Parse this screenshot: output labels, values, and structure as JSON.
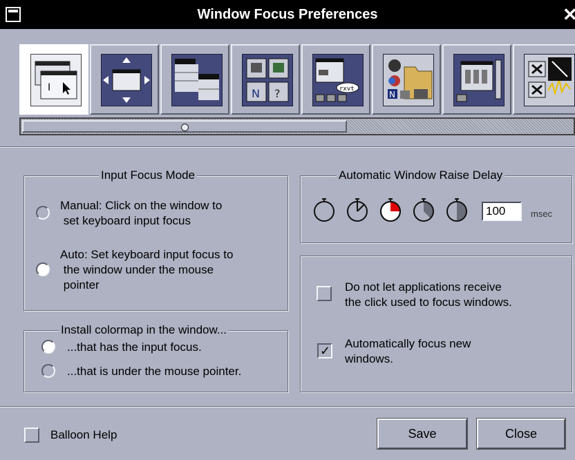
{
  "window": {
    "title": "Window Focus Preferences"
  },
  "toolbar": {
    "items": [
      {
        "icon": "focus-window-icon",
        "active": true
      },
      {
        "icon": "move-window-icon",
        "active": false
      },
      {
        "icon": "window-stack-icon",
        "active": false
      },
      {
        "icon": "icon-box-icon",
        "active": false
      },
      {
        "icon": "terminal-window-icon",
        "active": false
      },
      {
        "icon": "folder-apps-icon",
        "active": false
      },
      {
        "icon": "workspace-windows-icon",
        "active": false
      },
      {
        "icon": "close-window-icon",
        "active": false
      }
    ]
  },
  "input_focus": {
    "legend": "Input Focus Mode",
    "manual_line1": "Manual:  Click on the window to",
    "manual_line2": " set keyboard input focus",
    "auto_line1": "Auto:  Set keyboard input focus to",
    "auto_line2": " the window under the mouse",
    "auto_line3": " pointer",
    "selected": "auto"
  },
  "colormap": {
    "legend": "Install colormap in the window...",
    "option1": "...that has the input focus.",
    "option2": "...that is under the mouse pointer.",
    "selected": "option1"
  },
  "raise_delay": {
    "legend": "Automatic Window Raise Delay",
    "value": "100",
    "unit": "msec",
    "selected_timer": 3
  },
  "options": {
    "no_click_line1": "Do not let applications receive",
    "no_click_line2": "the click used to focus windows.",
    "no_click_checked": false,
    "auto_focus_line1": "Automatically focus new",
    "auto_focus_line2": "windows.",
    "auto_focus_checked": true
  },
  "footer": {
    "balloon_help": "Balloon Help",
    "save": "Save",
    "close": "Close"
  },
  "colors": {
    "background": "#aeb2c3",
    "titlebar": "#000000",
    "icon_bg": "#44497c",
    "timer_red": "#e00000"
  }
}
